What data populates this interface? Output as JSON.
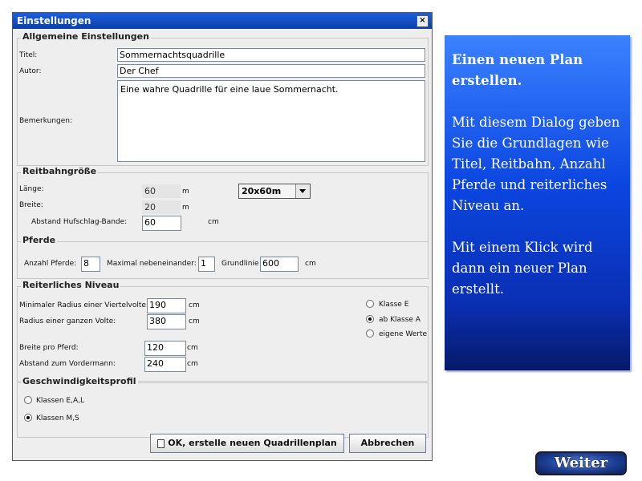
{
  "dialog": {
    "title": "Einstellungen",
    "close_glyph": "×"
  },
  "general": {
    "heading": "Allgemeine Einstellungen",
    "title_label": "Titel:",
    "title_value": "Sommernachtsquadrille",
    "author_label": "Autor:",
    "author_value": "Der Chef",
    "remarks_label": "Bemerkungen:",
    "remarks_value": "Eine wahre Quadrille für eine laue Sommernacht."
  },
  "arena": {
    "heading": "Reitbahngröße",
    "length_label": "Länge:",
    "length_value": "60",
    "length_unit": "m",
    "width_label": "Breite:",
    "width_value": "20",
    "width_unit": "m",
    "distance_label": "Abstand Hufschlag-Bande:",
    "distance_value": "60",
    "distance_unit": "cm",
    "size_select": "20x60m"
  },
  "horses": {
    "heading": "Pferde",
    "count_label": "Anzahl Pferde:",
    "count_value": "8",
    "max_label": "Maximal nebeneinander:",
    "max_value": "1",
    "baseline_label": "Grundlinie",
    "baseline_value": "600",
    "baseline_unit": "cm"
  },
  "level": {
    "heading": "Reiterliches Niveau",
    "min_radius_label": "Minimaler Radius einer Viertelvolte:",
    "min_radius_value": "190",
    "min_radius_unit": "cm",
    "full_radius_label": "Radius einer ganzen Volte:",
    "full_radius_value": "380",
    "full_radius_unit": "cm",
    "width_per_horse_label": "Breite pro Pferd:",
    "width_per_horse_value": "120",
    "width_per_horse_unit": "cm",
    "distance_front_label": "Abstand zum Vordermann:",
    "distance_front_value": "240",
    "distance_front_unit": "cm",
    "options": [
      "Klasse E",
      "ab Klasse A",
      "eigene Werte"
    ],
    "selected": "ab Klasse A"
  },
  "speed": {
    "heading": "Geschwindigkeitsprofil",
    "options": [
      "Klassen E,A,L",
      "Klassen M,S"
    ],
    "selected": "Klassen M,S"
  },
  "buttons": {
    "ok_label": "OK, erstelle neuen Quadrillenplan",
    "cancel_label": "Abbrechen"
  },
  "info": {
    "heading": "Einen neuen Plan erstellen.",
    "para1": "Mit diesem Dialog geben Sie die Grundlagen wie Titel, Reitbahn, Anzahl Pferde und reiterliches Niveau an.",
    "para2": "Mit einem Klick wird dann ein neuer Plan erstellt."
  },
  "next_button_label": "Weiter",
  "icons": {
    "close": "close-icon",
    "dropdown": "chevron-down-icon",
    "document": "document-icon"
  },
  "colors": {
    "titlebar": "#0a3fa8",
    "panel_top": "#3b82ff",
    "panel_bottom": "#061a6a"
  }
}
